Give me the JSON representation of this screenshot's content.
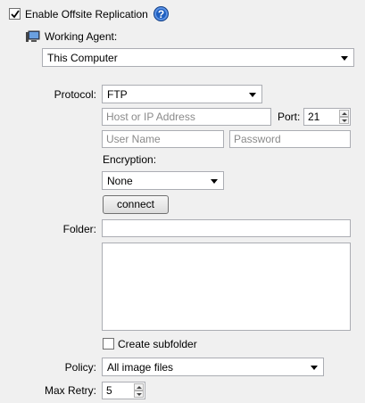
{
  "replication": {
    "enable_label": "Enable Offsite Replication",
    "enabled": true,
    "help_glyph": "?"
  },
  "agent": {
    "label": "Working Agent:",
    "icon": "computer-icon",
    "selected": "This Computer"
  },
  "protocol": {
    "label": "Protocol:",
    "selected": "FTP"
  },
  "host": {
    "value": "",
    "placeholder": "Host or IP Address"
  },
  "port": {
    "label": "Port:",
    "value": "21"
  },
  "credentials": {
    "username_placeholder": "User Name",
    "password_placeholder": "Password"
  },
  "encryption": {
    "label": "Encryption:",
    "selected": "None"
  },
  "connect_button": "connect",
  "folder": {
    "label": "Folder:",
    "value": ""
  },
  "subfolder": {
    "label": "Create subfolder",
    "checked": false
  },
  "policy": {
    "label": "Policy:",
    "selected": "All image files"
  },
  "max_retry": {
    "label": "Max Retry:",
    "value": "5"
  },
  "colors": {
    "help_blue": "#1f5fbf",
    "border": "#abadb3",
    "background": "#f0f0f0"
  }
}
